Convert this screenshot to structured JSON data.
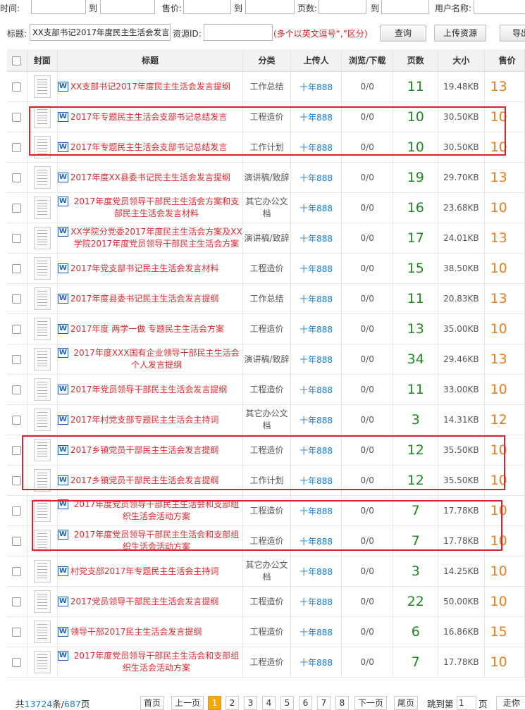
{
  "filters": {
    "time_label": "时间:",
    "to_label": "到",
    "price_label": "售价:",
    "pages_label": "页数:",
    "username_label": "用户名称:",
    "title_label": "标题:",
    "title_value": "XX支部书记2017年度民主生活会发言",
    "resource_id_label": "资源ID:",
    "resource_id_value": "",
    "hint": "(多个以英文逗号“,”区分)",
    "query_button": "查询",
    "upload_button": "上传资源",
    "export_button": "导出"
  },
  "columns": [
    "封面",
    "标题",
    "分类",
    "上传人",
    "浏览/下载",
    "页数",
    "大小",
    "售价"
  ],
  "rows": [
    {
      "title": "XX支部书记2017年度民主生活会发言提纲",
      "category": "工作总结",
      "uploader": "十年888",
      "views": "0/0",
      "pages": "11",
      "size": "19.48KB",
      "price": "13"
    },
    {
      "title": "2017年专题民主生活会支部书记总结发言",
      "category": "工程造价",
      "uploader": "十年888",
      "views": "0/0",
      "pages": "10",
      "size": "30.50KB",
      "price": "10"
    },
    {
      "title": "2017年专题民主生活会支部书记总结发言",
      "category": "工作计划",
      "uploader": "十年888",
      "views": "0/0",
      "pages": "10",
      "size": "30.50KB",
      "price": "10"
    },
    {
      "title": "2017年度XX县委书记民主生活会发言提纲",
      "category": "演讲稿/致辞",
      "uploader": "十年888",
      "views": "0/0",
      "pages": "19",
      "size": "29.70KB",
      "price": "13"
    },
    {
      "title": "2017年度党员领导干部民主生活会方案和支部民主生活会发言材料",
      "category": "其它办公文档",
      "uploader": "十年888",
      "views": "0/0",
      "pages": "16",
      "size": "23.68KB",
      "price": "10"
    },
    {
      "title": "XX学院分党委2017年度民主生活会方案及XX学院2017年度党员领导干部民主生活会方案",
      "category": "演讲稿/致辞",
      "uploader": "十年888",
      "views": "0/0",
      "pages": "17",
      "size": "24.01KB",
      "price": "13"
    },
    {
      "title": "2017年党支部书记民主生活会发言材料",
      "category": "工程造价",
      "uploader": "十年888",
      "views": "0/0",
      "pages": "15",
      "size": "38.50KB",
      "price": "10"
    },
    {
      "title": "2017年度县委书记民主生活会发言提纲",
      "category": "工作总结",
      "uploader": "十年888",
      "views": "0/0",
      "pages": "11",
      "size": "20.83KB",
      "price": "13"
    },
    {
      "title": "2017年度 两学一做 专题民主生活会方案",
      "category": "工程造价",
      "uploader": "十年888",
      "views": "0/0",
      "pages": "13",
      "size": "35.00KB",
      "price": "10"
    },
    {
      "title": "2017年度XXX国有企业领导干部民主生活会个人发言提纲",
      "category": "演讲稿/致辞",
      "uploader": "十年888",
      "views": "0/0",
      "pages": "34",
      "size": "29.46KB",
      "price": "13"
    },
    {
      "title": "2017年党员领导干部民主生活会发言提纲",
      "category": "工程造价",
      "uploader": "十年888",
      "views": "0/0",
      "pages": "11",
      "size": "33.00KB",
      "price": "10"
    },
    {
      "title": "2017年村党支部专题民主生活会主持词",
      "category": "其它办公文档",
      "uploader": "十年888",
      "views": "0/0",
      "pages": "3",
      "size": "14.31KB",
      "price": "12"
    },
    {
      "title": "2017乡镇党员干部民主生活会发言提纲",
      "category": "工程造价",
      "uploader": "十年888",
      "views": "0/0",
      "pages": "12",
      "size": "35.50KB",
      "price": "10"
    },
    {
      "title": "2017乡镇党员干部民主生活会发言提纲",
      "category": "工作计划",
      "uploader": "十年888",
      "views": "0/0",
      "pages": "12",
      "size": "35.50KB",
      "price": "10"
    },
    {
      "title": "2017年度党员领导干部民主生活会和支部组织生活会活动方案",
      "category": "工程造价",
      "uploader": "十年888",
      "views": "0/0",
      "pages": "7",
      "size": "17.78KB",
      "price": "10"
    },
    {
      "title": "2017年度党员领导干部民主生活会和支部组织生活会活动方案",
      "category": "工程造价",
      "uploader": "十年888",
      "views": "0/0",
      "pages": "7",
      "size": "17.78KB",
      "price": "10"
    },
    {
      "title": "村党支部2017年专题民主生活会主持词",
      "category": "其它办公文档",
      "uploader": "十年888",
      "views": "0/0",
      "pages": "3",
      "size": "14.25KB",
      "price": "10"
    },
    {
      "title": "2017党员领导干部民主生活会发言提纲",
      "category": "工程造价",
      "uploader": "十年888",
      "views": "0/0",
      "pages": "22",
      "size": "50.00KB",
      "price": "10"
    },
    {
      "title": "领导干部2017民主生活会发言提纲",
      "category": "工程造价",
      "uploader": "十年888",
      "views": "0/0",
      "pages": "6",
      "size": "16.86KB",
      "price": "15"
    },
    {
      "title": "2017年度党员领导干部民主生活会和支部组织生活会活动方案",
      "category": "工程造价",
      "uploader": "十年888",
      "views": "0/0",
      "pages": "7",
      "size": "17.78KB",
      "price": "10"
    }
  ],
  "pagination": {
    "total_prefix": "共",
    "total_count": "13724",
    "total_mid": "条/",
    "total_pages": "687",
    "total_suffix": "页",
    "first": "首页",
    "prev": "上一页",
    "pages": [
      "1",
      "2",
      "3",
      "4",
      "5",
      "6",
      "7",
      "8"
    ],
    "current": "1",
    "next": "下一页",
    "last": "尾页",
    "jump_prefix": "跳到第",
    "jump_value": "1",
    "jump_suffix": "页",
    "go": "走你"
  },
  "colors": {
    "title_red": "#e0282e",
    "uploader_blue": "#1a7bd4",
    "pages_green": "#1f8a1f",
    "price_orange": "#f07c1b",
    "highlight_red": "#e0202a",
    "page_active": "#f7a700"
  }
}
